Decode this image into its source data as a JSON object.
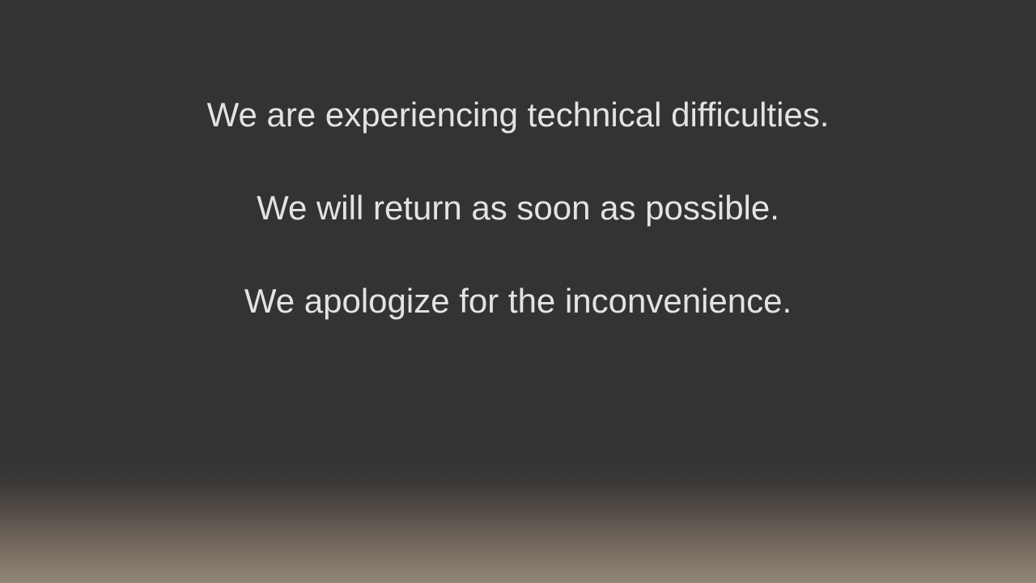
{
  "slide": {
    "lines": [
      "We are experiencing technical difficulties.",
      "We will return as soon as possible.",
      "We apologize for the inconvenience."
    ]
  },
  "colors": {
    "background_top": "#333333",
    "background_bottom": "#928677",
    "text": "#e3e3e3"
  }
}
